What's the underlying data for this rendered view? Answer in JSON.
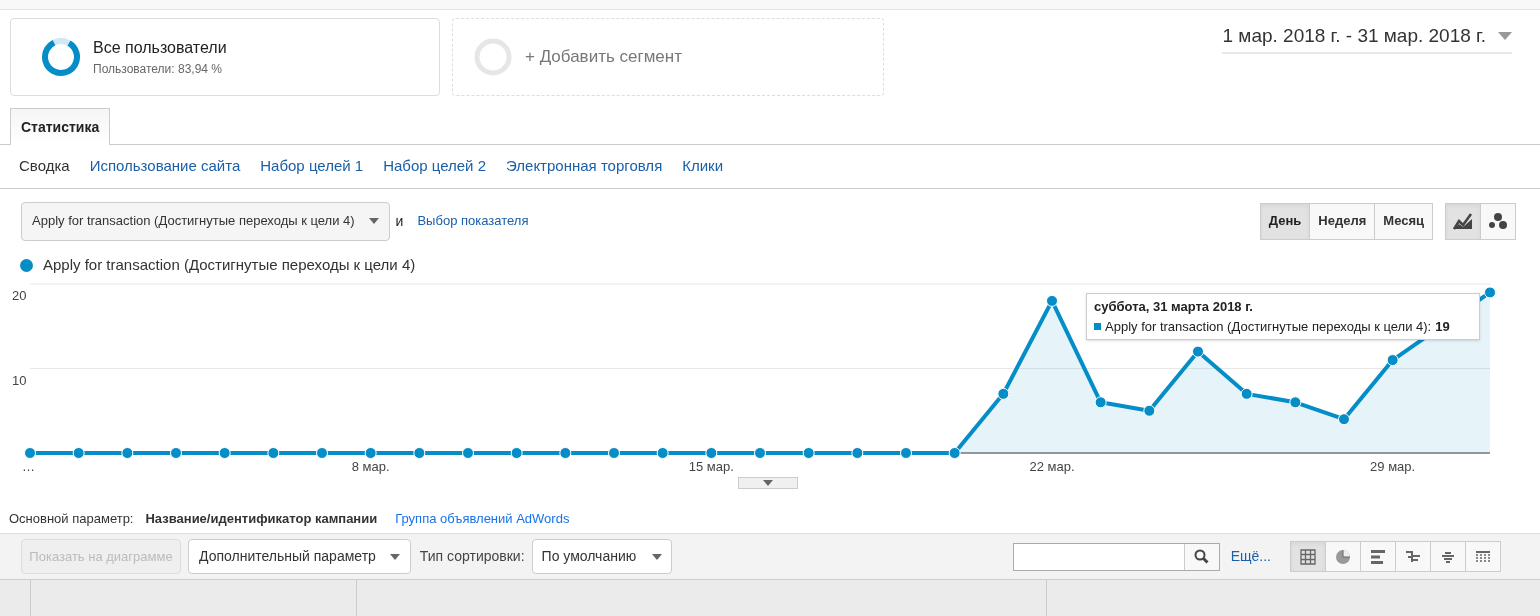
{
  "segments": [
    {
      "title": "Все пользователи",
      "subtitle": "Пользователи: 83,94 %"
    }
  ],
  "add_segment": {
    "label": "+ Добавить сегмент"
  },
  "date_range": "1 мар. 2018 г. - 31 мар. 2018 г.",
  "tabs": [
    {
      "label": "Статистика",
      "selected": true
    }
  ],
  "report_nav": [
    {
      "label": "Сводка",
      "selected": true
    },
    {
      "label": "Использование сайта",
      "selected": false
    },
    {
      "label": "Набор целей 1",
      "selected": false
    },
    {
      "label": "Набор целей 2",
      "selected": false
    },
    {
      "label": "Электронная торговля",
      "selected": false
    },
    {
      "label": "Клики",
      "selected": false
    }
  ],
  "metric_select": "Apply for transaction (Достигнутые переходы к цели 4)",
  "conjunction": "и",
  "metric_link": "Выбор показателя",
  "periods": [
    {
      "label": "День",
      "selected": true
    },
    {
      "label": "Неделя",
      "selected": false
    },
    {
      "label": "Месяц",
      "selected": false
    }
  ],
  "chart_types": [
    {
      "kind": "line",
      "selected": true
    },
    {
      "kind": "motion",
      "selected": false
    }
  ],
  "chart_data": {
    "type": "area",
    "x": [
      1,
      2,
      3,
      4,
      5,
      6,
      7,
      8,
      9,
      10,
      11,
      12,
      13,
      14,
      15,
      16,
      17,
      18,
      19,
      20,
      21,
      22,
      23,
      24,
      25,
      26,
      27,
      28,
      29,
      30,
      31
    ],
    "series": [
      {
        "name": "Apply for transaction (Достигнутые переходы к цели 4)",
        "color": "#058dc7",
        "values": [
          0,
          0,
          0,
          0,
          0,
          0,
          0,
          0,
          0,
          0,
          0,
          0,
          0,
          0,
          0,
          0,
          0,
          0,
          0,
          0,
          7,
          18,
          6,
          5,
          12,
          7,
          6,
          4,
          11,
          null,
          19
        ]
      }
    ],
    "xlim": [
      1,
      31
    ],
    "ylim": [
      0,
      20
    ],
    "yticks": [
      10,
      20
    ],
    "xticks": [
      {
        "value": 1,
        "label": "…"
      },
      {
        "value": 8,
        "label": "8 мар."
      },
      {
        "value": 15,
        "label": "15 мар."
      },
      {
        "value": 22,
        "label": "22 мар."
      },
      {
        "value": 29,
        "label": "29 мар."
      }
    ]
  },
  "tooltip": {
    "title": "суббота, 31 марта 2018 г.",
    "label": "Apply for transaction (Достигнутые переходы к цели 4):",
    "value": "19"
  },
  "primary_dimension": {
    "label": "Основной параметр:",
    "options": [
      {
        "label": "Название/идентификатор кампании",
        "selected": true
      },
      {
        "label": "Группа объявлений AdWords",
        "selected": false
      }
    ]
  },
  "toolbar": {
    "show_on_chart": {
      "label": "Показать на диаграмме",
      "disabled": true
    },
    "secondary_dimension": "Дополнительный параметр",
    "sort_label": "Тип сортировки:",
    "sort_value": "По умолчанию",
    "more_link": "Ещё..."
  },
  "views": [
    {
      "kind": "table",
      "selected": true
    },
    {
      "kind": "pie",
      "selected": false
    },
    {
      "kind": "bars",
      "selected": false
    },
    {
      "kind": "compare",
      "selected": false
    },
    {
      "kind": "terms",
      "selected": false
    },
    {
      "kind": "pivot",
      "selected": false
    }
  ]
}
